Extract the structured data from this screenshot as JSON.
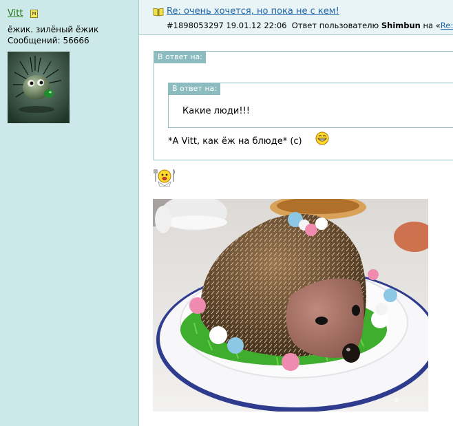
{
  "author": {
    "name": "Vitt",
    "badge": "M",
    "status": "ёжик. зилёный ёжик",
    "posts_label": "Сообщений: 56666"
  },
  "post": {
    "title": "Re: очень хочется, но пока не с кем!",
    "meta_id_date": "#1898053297 19.01.12 22:06",
    "meta_reply_prefix": "Ответ пользователю",
    "meta_user": "Shimbun",
    "meta_on": "на «",
    "meta_link": "Re: о"
  },
  "quote_outer": {
    "label": "В ответ на:",
    "text": "*А Vitt, как ёж на блюде* (с)"
  },
  "quote_inner": {
    "label": "В ответ на:",
    "text": "Какие люди!!!"
  },
  "icons": {
    "title_icon": "book-icon",
    "smiley_1": "grin-smiley-icon",
    "smiley_2": "chef-smiley-icon"
  },
  "colors": {
    "sidebar_bg": "#cde8e9",
    "header_bg": "#e8f4f5",
    "link": "#2266aa",
    "author_name": "#2a7a1e",
    "quote_border": "#8cbcbf"
  }
}
